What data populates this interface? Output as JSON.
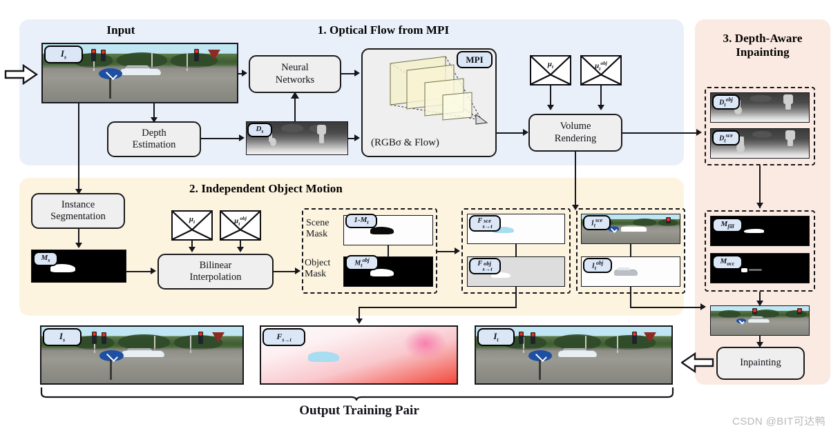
{
  "figure": {
    "watermark": "CSDN @BIT可达鸭",
    "output_label": "Output Training Pair"
  },
  "sections": [
    {
      "id": "input",
      "title": "Input",
      "color": "#eaf0fa"
    },
    {
      "id": "optical",
      "title": "1. Optical Flow from MPI",
      "color": "#eaf0fa"
    },
    {
      "id": "motion",
      "title": "2. Independent Object Motion",
      "color": "#fdf4e0"
    },
    {
      "id": "inpainting",
      "title": "3. Depth-Aware\nInpainting",
      "color": "#fbeae2"
    }
  ],
  "boxes": {
    "neural_networks": "Neural\nNetworks",
    "depth_estimation": "Depth\nEstimation",
    "mpi_caption": "(RGBσ & Flow)",
    "volume_rendering": "Volume\nRendering",
    "instance_segmentation": "Instance\nSegmentation",
    "bilinear_interpolation": "Bilinear\nInterpolation",
    "inpainting": "Inpainting"
  },
  "tags": {
    "input_source": "I_s",
    "mpi": "MPI",
    "depth_source": "D_s",
    "depth_target_obj": "D_t^obj",
    "depth_target_sce": "D_t^sce",
    "mask_source": "M_s",
    "scene_mask_value": "1-M_t",
    "object_mask_value": "M_t^obj",
    "flow_sce": "F_s→t^sce",
    "flow_obj": "F_s→t^obj",
    "image_target_sce": "I_t^sce",
    "image_target_obj": "I_t^obj",
    "mask_fill": "M_fill",
    "mask_occ": "M_occ",
    "output_source": "I_s",
    "output_flow": "F_s→t",
    "output_target": "I_t"
  },
  "labels": {
    "scene_mask": "Scene\nMask",
    "object_mask": "Object\nMask",
    "mu_t": "μ_t",
    "mu_t_obj": "μ_t^obj"
  },
  "colors": {
    "panel_blue": "#eaf0fa",
    "panel_cream": "#fdf4e0",
    "panel_pink": "#fbeae2",
    "tag_fill": "#dbe7f6",
    "box_fill": "#efefef",
    "mpi_plane": "#f5f2cd",
    "stroke": "#15151a"
  }
}
